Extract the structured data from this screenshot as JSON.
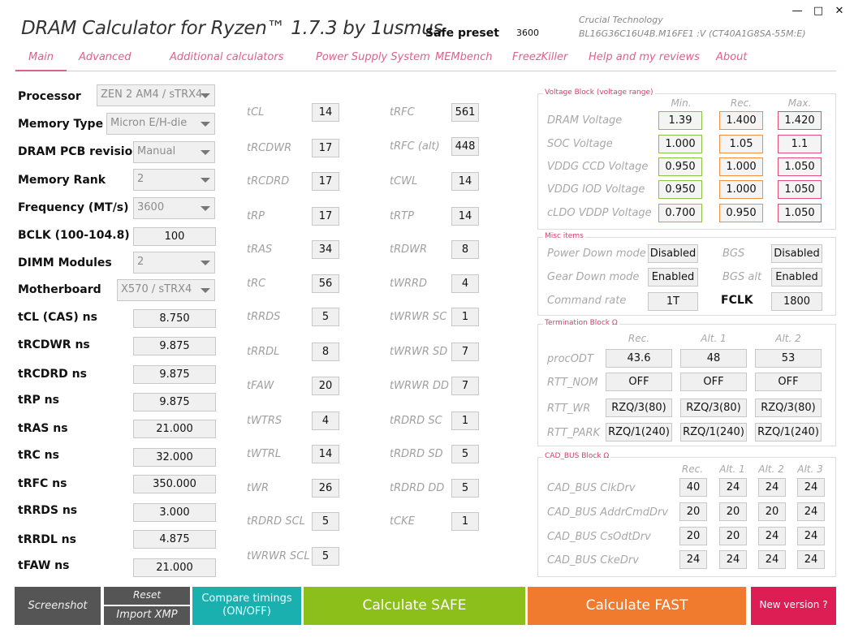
{
  "header": {
    "title": "DRAM Calculator for Ryzen™ 1.7.3 by 1usmus",
    "safe_preset_label": "Safe preset",
    "safe_preset_value": "3600",
    "memory_vendor": "Crucial Technology",
    "memory_part": "BL16G36C16U4B.M16FE1 :V (CT40A1G8SA-55M:E)",
    "window_controls": {
      "minimize": "—",
      "maximize": "□",
      "close": "✕"
    }
  },
  "tabs": [
    {
      "label": "Main",
      "active": true
    },
    {
      "label": "Advanced",
      "active": false
    },
    {
      "label": "Additional calculators",
      "active": false
    },
    {
      "label": "Power Supply System",
      "active": false
    },
    {
      "label": "MEMbench",
      "active": false
    },
    {
      "label": "FreezKiller",
      "active": false
    },
    {
      "label": "Help and my reviews",
      "active": false
    },
    {
      "label": "About",
      "active": false
    }
  ],
  "settings": {
    "processor": {
      "label": "Processor",
      "value": "ZEN 2 AM4 / sTRX4"
    },
    "memory_type": {
      "label": "Memory Type",
      "value": "Micron E/H-die"
    },
    "pcb_revision": {
      "label": "DRAM PCB revision",
      "value": "Manual"
    },
    "memory_rank": {
      "label": "Memory Rank",
      "value": "2"
    },
    "frequency": {
      "label": "Frequency (MT/s)",
      "value": "3600"
    },
    "bclk": {
      "label": "BCLK (100-104.8)",
      "value": "100"
    },
    "dimm_modules": {
      "label": "DIMM Modules",
      "value": "2"
    },
    "motherboard": {
      "label": "Motherboard",
      "value": "X570 / sTRX4"
    }
  },
  "ns_values": [
    {
      "label": "tCL (CAS) ns",
      "value": "8.750"
    },
    {
      "label": "tRCDWR ns",
      "value": "9.875"
    },
    {
      "label": "tRCDRD ns",
      "value": "9.875"
    },
    {
      "label": "tRP ns",
      "value": "9.875"
    },
    {
      "label": "tRAS ns",
      "value": "21.000"
    },
    {
      "label": "tRC ns",
      "value": "32.000"
    },
    {
      "label": "tRFC ns",
      "value": "350.000"
    },
    {
      "label": "tRRDS ns",
      "value": "3.000"
    },
    {
      "label": "tRRDL ns",
      "value": "4.875"
    },
    {
      "label": "tFAW ns",
      "value": "21.000"
    }
  ],
  "timings_left": [
    {
      "label": "tCL",
      "value": "14"
    },
    {
      "label": "tRCDWR",
      "value": "17"
    },
    {
      "label": "tRCDRD",
      "value": "17"
    },
    {
      "label": "tRP",
      "value": "17"
    },
    {
      "label": "tRAS",
      "value": "34"
    },
    {
      "label": "tRC",
      "value": "56"
    },
    {
      "label": "tRRDS",
      "value": "5"
    },
    {
      "label": "tRRDL",
      "value": "8"
    },
    {
      "label": "tFAW",
      "value": "20"
    },
    {
      "label": "tWTRS",
      "value": "4"
    },
    {
      "label": "tWTRL",
      "value": "14"
    },
    {
      "label": "tWR",
      "value": "26"
    },
    {
      "label": "tRDRD SCL",
      "value": "5"
    },
    {
      "label": "tWRWR SCL",
      "value": "5"
    }
  ],
  "timings_right": [
    {
      "label": "tRFC",
      "value": "561"
    },
    {
      "label": "tRFC (alt)",
      "value": "448"
    },
    {
      "label": "tCWL",
      "value": "14"
    },
    {
      "label": "tRTP",
      "value": "14"
    },
    {
      "label": "tRDWR",
      "value": "8"
    },
    {
      "label": "tWRRD",
      "value": "4"
    },
    {
      "label": "tWRWR SC",
      "value": "1"
    },
    {
      "label": "tWRWR SD",
      "value": "7"
    },
    {
      "label": "tWRWR DD",
      "value": "7"
    },
    {
      "label": "tRDRD SC",
      "value": "1"
    },
    {
      "label": "tRDRD SD",
      "value": "5"
    },
    {
      "label": "tRDRD DD",
      "value": "5"
    },
    {
      "label": "tCKE",
      "value": "1"
    }
  ],
  "voltage_block": {
    "title": "Voltage Block (voltage range)",
    "headers": [
      "Min.",
      "Rec.",
      "Max."
    ],
    "rows": [
      {
        "label": "DRAM Voltage",
        "min": "1.39",
        "rec": "1.400",
        "max": "1.420"
      },
      {
        "label": "SOC Voltage",
        "min": "1.000",
        "rec": "1.05",
        "max": "1.1"
      },
      {
        "label": "VDDG  CCD Voltage",
        "min": "0.950",
        "rec": "1.000",
        "max": "1.050"
      },
      {
        "label": "VDDG  IOD Voltage",
        "min": "0.950",
        "rec": "1.000",
        "max": "1.050"
      },
      {
        "label": "cLDO VDDP Voltage",
        "min": "0.700",
        "rec": "0.950",
        "max": "1.050"
      }
    ]
  },
  "misc_block": {
    "title": "Misc items",
    "power_down_label": "Power Down mode",
    "power_down_value": "Disabled",
    "bgs_label": "BGS",
    "bgs_value": "Disabled",
    "gear_down_label": "Gear Down mode",
    "gear_down_value": "Enabled",
    "bgs_alt_label": "BGS alt",
    "bgs_alt_value": "Enabled",
    "command_rate_label": "Command rate",
    "command_rate_value": "1T",
    "fclk_label": "FCLK",
    "fclk_value": "1800"
  },
  "termination_block": {
    "title": "Termination Block Ω",
    "headers": [
      "Rec.",
      "Alt. 1",
      "Alt. 2"
    ],
    "rows": [
      {
        "label": "procODT",
        "values": [
          "43.6",
          "48",
          "53"
        ]
      },
      {
        "label": "RTT_NOM",
        "values": [
          "OFF",
          "OFF",
          "OFF"
        ]
      },
      {
        "label": "RTT_WR",
        "values": [
          "RZQ/3(80)",
          "RZQ/3(80)",
          "RZQ/3(80)"
        ]
      },
      {
        "label": "RTT_PARK",
        "values": [
          "RZQ/1(240)",
          "RZQ/1(240)",
          "RZQ/1(240)"
        ]
      }
    ]
  },
  "cadbus_block": {
    "title": "CAD_BUS Block Ω",
    "headers": [
      "Rec.",
      "Alt. 1",
      "Alt. 2",
      "Alt. 3"
    ],
    "rows": [
      {
        "label": "CAD_BUS ClkDrv",
        "values": [
          "40",
          "24",
          "24",
          "24"
        ]
      },
      {
        "label": "CAD_BUS AddrCmdDrv",
        "values": [
          "20",
          "20",
          "20",
          "24"
        ]
      },
      {
        "label": "CAD_BUS CsOdtDrv",
        "values": [
          "20",
          "20",
          "24",
          "24"
        ]
      },
      {
        "label": "CAD_BUS CkeDrv",
        "values": [
          "24",
          "24",
          "24",
          "24"
        ]
      }
    ]
  },
  "buttons": {
    "screenshot": "Screenshot",
    "reset": "Reset",
    "import_xmp": "Import XMP",
    "compare_line1": "Compare timings",
    "compare_line2": "(ON/OFF)",
    "calc_safe": "Calculate SAFE",
    "calc_fast": "Calculate FAST",
    "new_version": "New version ?"
  }
}
